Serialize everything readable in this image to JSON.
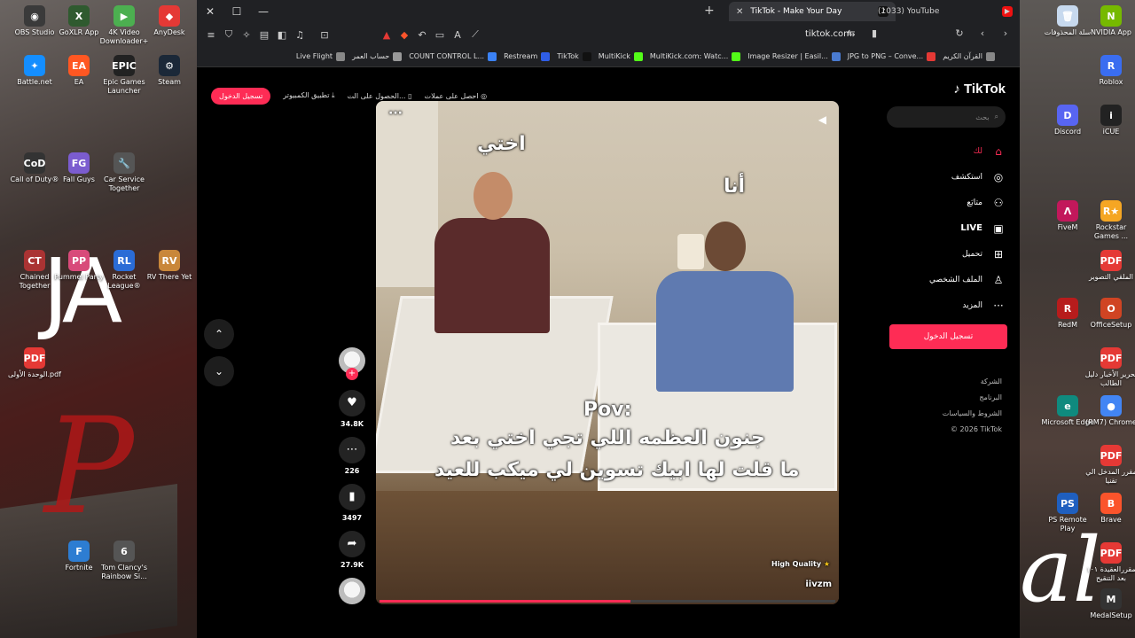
{
  "desktop": {
    "left_icons": [
      {
        "label": "OBS Studio",
        "color": "#3a3a3a",
        "glyph": "◉"
      },
      {
        "label": "GoXLR App",
        "color": "#2f5a2f",
        "glyph": "X"
      },
      {
        "label": "4K Video Downloader+",
        "color": "#4caf50",
        "glyph": "▶"
      },
      {
        "label": "AnyDesk",
        "color": "#e53935",
        "glyph": "◆"
      },
      {
        "label": "Battle.net",
        "color": "#148eff",
        "glyph": "✦"
      },
      {
        "label": "EA",
        "color": "#ff5722",
        "glyph": "EA"
      },
      {
        "label": "Epic Games Launcher",
        "color": "#222222",
        "glyph": "EPIC"
      },
      {
        "label": "Steam",
        "color": "#1b2838",
        "glyph": "⚙"
      },
      {
        "label": "Call of Duty®",
        "color": "#333333",
        "glyph": "CoD"
      },
      {
        "label": "Fall Guys",
        "color": "#7b5ccf",
        "glyph": "FG"
      },
      {
        "label": "Car Service Together",
        "color": "#555555",
        "glyph": "🔧"
      },
      {
        "label": "Chained Together",
        "color": "#a33",
        "glyph": "CT"
      },
      {
        "label": "Pummel Party",
        "color": "#d84a7a",
        "glyph": "PP"
      },
      {
        "label": "Rocket League®",
        "color": "#2a6cd6",
        "glyph": "RL"
      },
      {
        "label": "RV There Yet",
        "color": "#c9873a",
        "glyph": "RV"
      },
      {
        "label": "الوحدة الأولى.pdf",
        "color": "#e53935",
        "glyph": "PDF"
      },
      {
        "label": "Fortnite",
        "color": "#2d7dd2",
        "glyph": "F"
      },
      {
        "label": "Tom Clancy's Rainbow Si...",
        "color": "#555555",
        "glyph": "6"
      }
    ],
    "right_icons": [
      {
        "label": "سلة المحذوفات",
        "color": "#c7d9ee",
        "glyph": "🗑"
      },
      {
        "label": "NVIDIA App",
        "color": "#76b900",
        "glyph": "N"
      },
      {
        "label": "Roblox",
        "color": "#3a6df0",
        "glyph": "R"
      },
      {
        "label": "Discord",
        "color": "#5865f2",
        "glyph": "D"
      },
      {
        "label": "iCUE",
        "color": "#222222",
        "glyph": "i"
      },
      {
        "label": "FiveM",
        "color": "#c2185b",
        "glyph": "Λ"
      },
      {
        "label": "Rockstar Games ...",
        "color": "#f5a623",
        "glyph": "R★"
      },
      {
        "label": "الملقي التصوير",
        "color": "#e53935",
        "glyph": "PDF"
      },
      {
        "label": "RedM",
        "color": "#b71c1c",
        "glyph": "R"
      },
      {
        "label": "OfficeSetup",
        "color": "#d04423",
        "glyph": "O"
      },
      {
        "label": "تحرير الأخبار دليل الطالب",
        "color": "#e53935",
        "glyph": "PDF"
      },
      {
        "label": "Microsoft Edge",
        "color": "#0f8a7e",
        "glyph": "e"
      },
      {
        "label": "(RM7) Chrome",
        "color": "#4285f4",
        "glyph": "●"
      },
      {
        "label": "مقرر المدخل الي تقنيا",
        "color": "#e53935",
        "glyph": "PDF"
      },
      {
        "label": "PS Remote Play",
        "color": "#1f5fbf",
        "glyph": "PS"
      },
      {
        "label": "Brave",
        "color": "#fb542b",
        "glyph": "B"
      },
      {
        "label": "مقررالعقيدة ١٠١ بعد التنقيح",
        "color": "#e53935",
        "glyph": "PDF"
      },
      {
        "label": "MedalSetup",
        "color": "#333333",
        "glyph": "M"
      }
    ]
  },
  "browser": {
    "tabs": [
      {
        "title": "TikTok - Make Your Day",
        "close": "✕",
        "fav": "♪"
      },
      {
        "title": "(1033) YouTube",
        "fav": "▶"
      }
    ],
    "window_controls": {
      "close": "✕",
      "maximize": "☐",
      "minimize": "—"
    },
    "new_tab": "+",
    "url": "tiktok.com",
    "bookmarks": [
      {
        "label": "Live Flight",
        "color": "#888888"
      },
      {
        "label": "حساب العمر",
        "color": "#999999"
      },
      {
        "label": "COUNT CONTROL L...",
        "color": "#3b82f6"
      },
      {
        "label": "Restream",
        "color": "#2f5ee8"
      },
      {
        "label": "TikTok",
        "color": "#111111"
      },
      {
        "label": "MultiKick",
        "color": "#53fc18"
      },
      {
        "label": "MultiKick.com: Watc...",
        "color": "#53fc18"
      },
      {
        "label": "Image Resizer | Easil...",
        "color": "#4a7bd0"
      },
      {
        "label": "JPG to PNG – Conve...",
        "color": "#e53935"
      },
      {
        "label": "القرآن الكريم",
        "color": "#888888"
      }
    ]
  },
  "tiktok": {
    "logo": "TikTok",
    "search_placeholder": "بحث",
    "top_links": {
      "coins": "احصل على عملات",
      "get_app": "الحصول على الت...",
      "pc_app": "تطبيق الكمبيوتر",
      "login": "تسجيل الدخول"
    },
    "nav": [
      {
        "label": "لك",
        "icon": "⌂"
      },
      {
        "label": "استكشف",
        "icon": "◎"
      },
      {
        "label": "متابَع",
        "icon": "⚇"
      },
      {
        "label": "LIVE",
        "icon": "▣"
      },
      {
        "label": "تحميل",
        "icon": "⊞"
      },
      {
        "label": "الملف الشخصي",
        "icon": "♙"
      },
      {
        "label": "المزيد",
        "icon": "···"
      }
    ],
    "side_login": "تسجيل الدخول",
    "footer": [
      "الشركة",
      "البرنامج",
      "الشروط والسياسات",
      "© 2026 TikTok"
    ],
    "video": {
      "label_sister": "اختي",
      "label_me": "أنا",
      "pov": "Pov:",
      "caption_line1": "جنون العظمه اللي تجي اختي بعد",
      "caption_line2": "ما قلت لها ابيك تسوين لي ميكب للعيد",
      "quality": "High Quality",
      "username": "iivzm",
      "more": "···",
      "progress": 0.55
    },
    "actions": {
      "likes": "34.8K",
      "comments": "226",
      "saves": "3497",
      "shares": "27.9K"
    }
  }
}
